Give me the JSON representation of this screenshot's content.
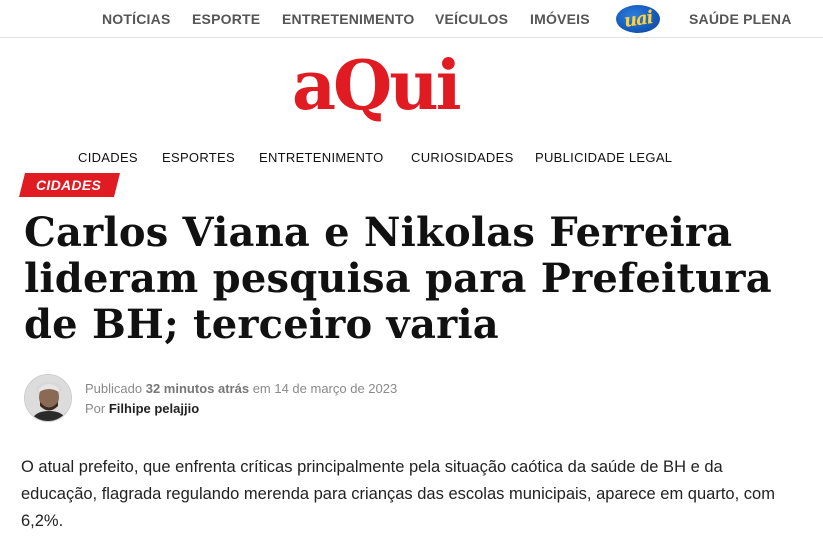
{
  "top_nav": {
    "items": [
      "NOTÍCIAS",
      "ESPORTE",
      "ENTRETENIMENTO",
      "VEÍCULOS",
      "IMÓVEIS"
    ],
    "partner_logo": "uai",
    "last_item": "SAÚDE PLENA"
  },
  "site": {
    "logo": "aQui",
    "brand_color": "#e11b22"
  },
  "section_nav": {
    "items": [
      "CIDADES",
      "ESPORTES",
      "ENTRETENIMENTO",
      "CURIOSIDADES",
      "PUBLICIDADE LEGAL"
    ]
  },
  "article": {
    "category": "CIDADES",
    "headline": "Carlos Viana e Nikolas Ferreira lideram pesquisa para Prefeitura de BH; terceiro varia",
    "published_prefix": "Publicado",
    "published_relative": "32 minutos atrás",
    "published_suffix": "em 14 de março de 2023",
    "by_label": "Por",
    "author": "Filhipe pelajjio",
    "body": "O atual prefeito, que enfrenta críticas principalmente pela situação caótica da saúde de BH e da educação, flagrada regulando merenda para crianças das escolas municipais, aparece em quarto, com 6,2%."
  }
}
